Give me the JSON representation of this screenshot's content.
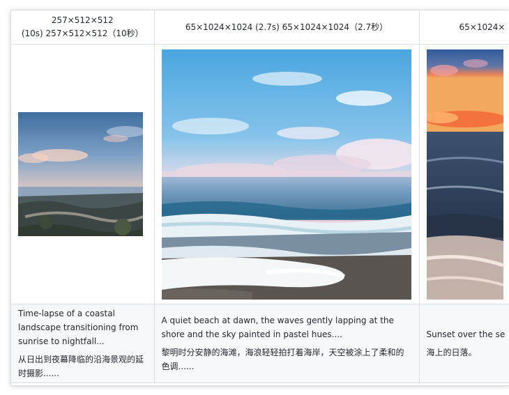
{
  "columns": [
    {
      "header_line1": "257×512×512",
      "header_line2": "(10s) 257×512×512（10秒）",
      "video_subject": "coastal time-lapse landscape",
      "caption_en": "Time-lapse of a coastal landscape transitioning from sunrise to nightfall...",
      "caption_zh": "从日出到夜幕降临的沿海景观的延时摄影......"
    },
    {
      "header_line1": "65×1024×1024 (2.7s) 65×1024×1024（2.7秒）",
      "video_subject": "quiet beach at dawn",
      "caption_en": "A quiet beach at dawn, the waves gently lapping at the shore and the sky painted in pastel hues....",
      "caption_zh": "黎明时分安静的海滩，海浪轻轻拍打着海岸，天空被涂上了柔和的色调......"
    },
    {
      "header_line1": "65×1024×",
      "video_subject": "sunset over the sea",
      "caption_en": "Sunset over the se",
      "caption_zh": "海上的日落。"
    }
  ],
  "colors": {
    "border": "#d8dee4",
    "caption_bg": "#f6f8fa",
    "text": "#24292f"
  }
}
